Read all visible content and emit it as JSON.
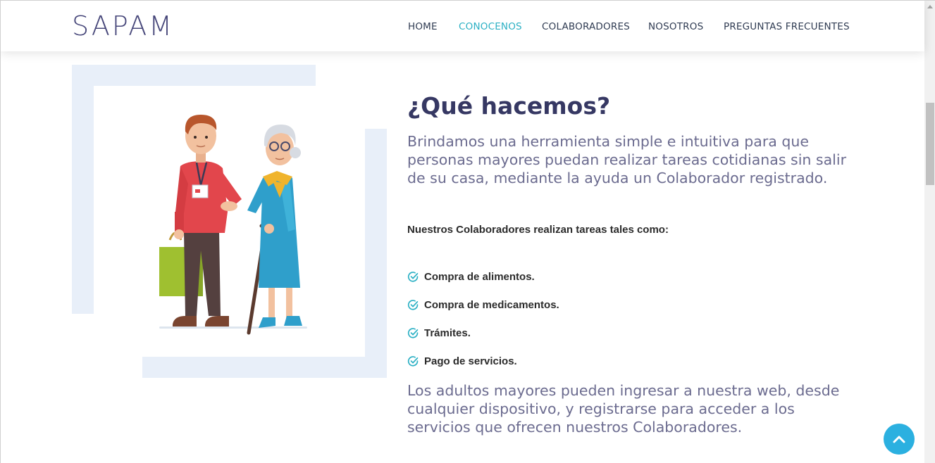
{
  "header": {
    "logo": "SAPAM",
    "nav": [
      {
        "label": "HOME",
        "active": false
      },
      {
        "label": "CONOCENOS",
        "active": true
      },
      {
        "label": "COLABORADORES",
        "active": false
      },
      {
        "label": "NOSOTROS",
        "active": false
      },
      {
        "label": "PREGUNTAS FRECUENTES",
        "active": false
      }
    ]
  },
  "section": {
    "title": "¿Qué hacemos?",
    "lead": "Brindamos una herramienta simple e intuitiva para que personas mayores puedan realizar tareas cotidianas sin salir de su casa, mediante la ayuda un Colaborador registrado.",
    "subtitle": "Nuestros Colaboradores realizan tareas tales como:",
    "tasks": [
      "Compra de alimentos.",
      "Compra de medicamentos.",
      "Trámites.",
      "Pago de servicios."
    ],
    "closing": "Los adultos mayores pueden ingresar a nuestra web, desde cualquier dispositivo, y registrarse para acceder a los servicios que ofrecen nuestros Colaboradores."
  },
  "icons": {
    "task_check": "check-circle-icon",
    "back_to_top": "chevron-up-icon"
  },
  "colors": {
    "accent": "#2bb0c4",
    "brand_text": "#47477a",
    "heading": "#363863",
    "body_text": "#6b6b8f",
    "frame_bg": "#e8eff9",
    "to_top_button": "#2bb0e0"
  }
}
